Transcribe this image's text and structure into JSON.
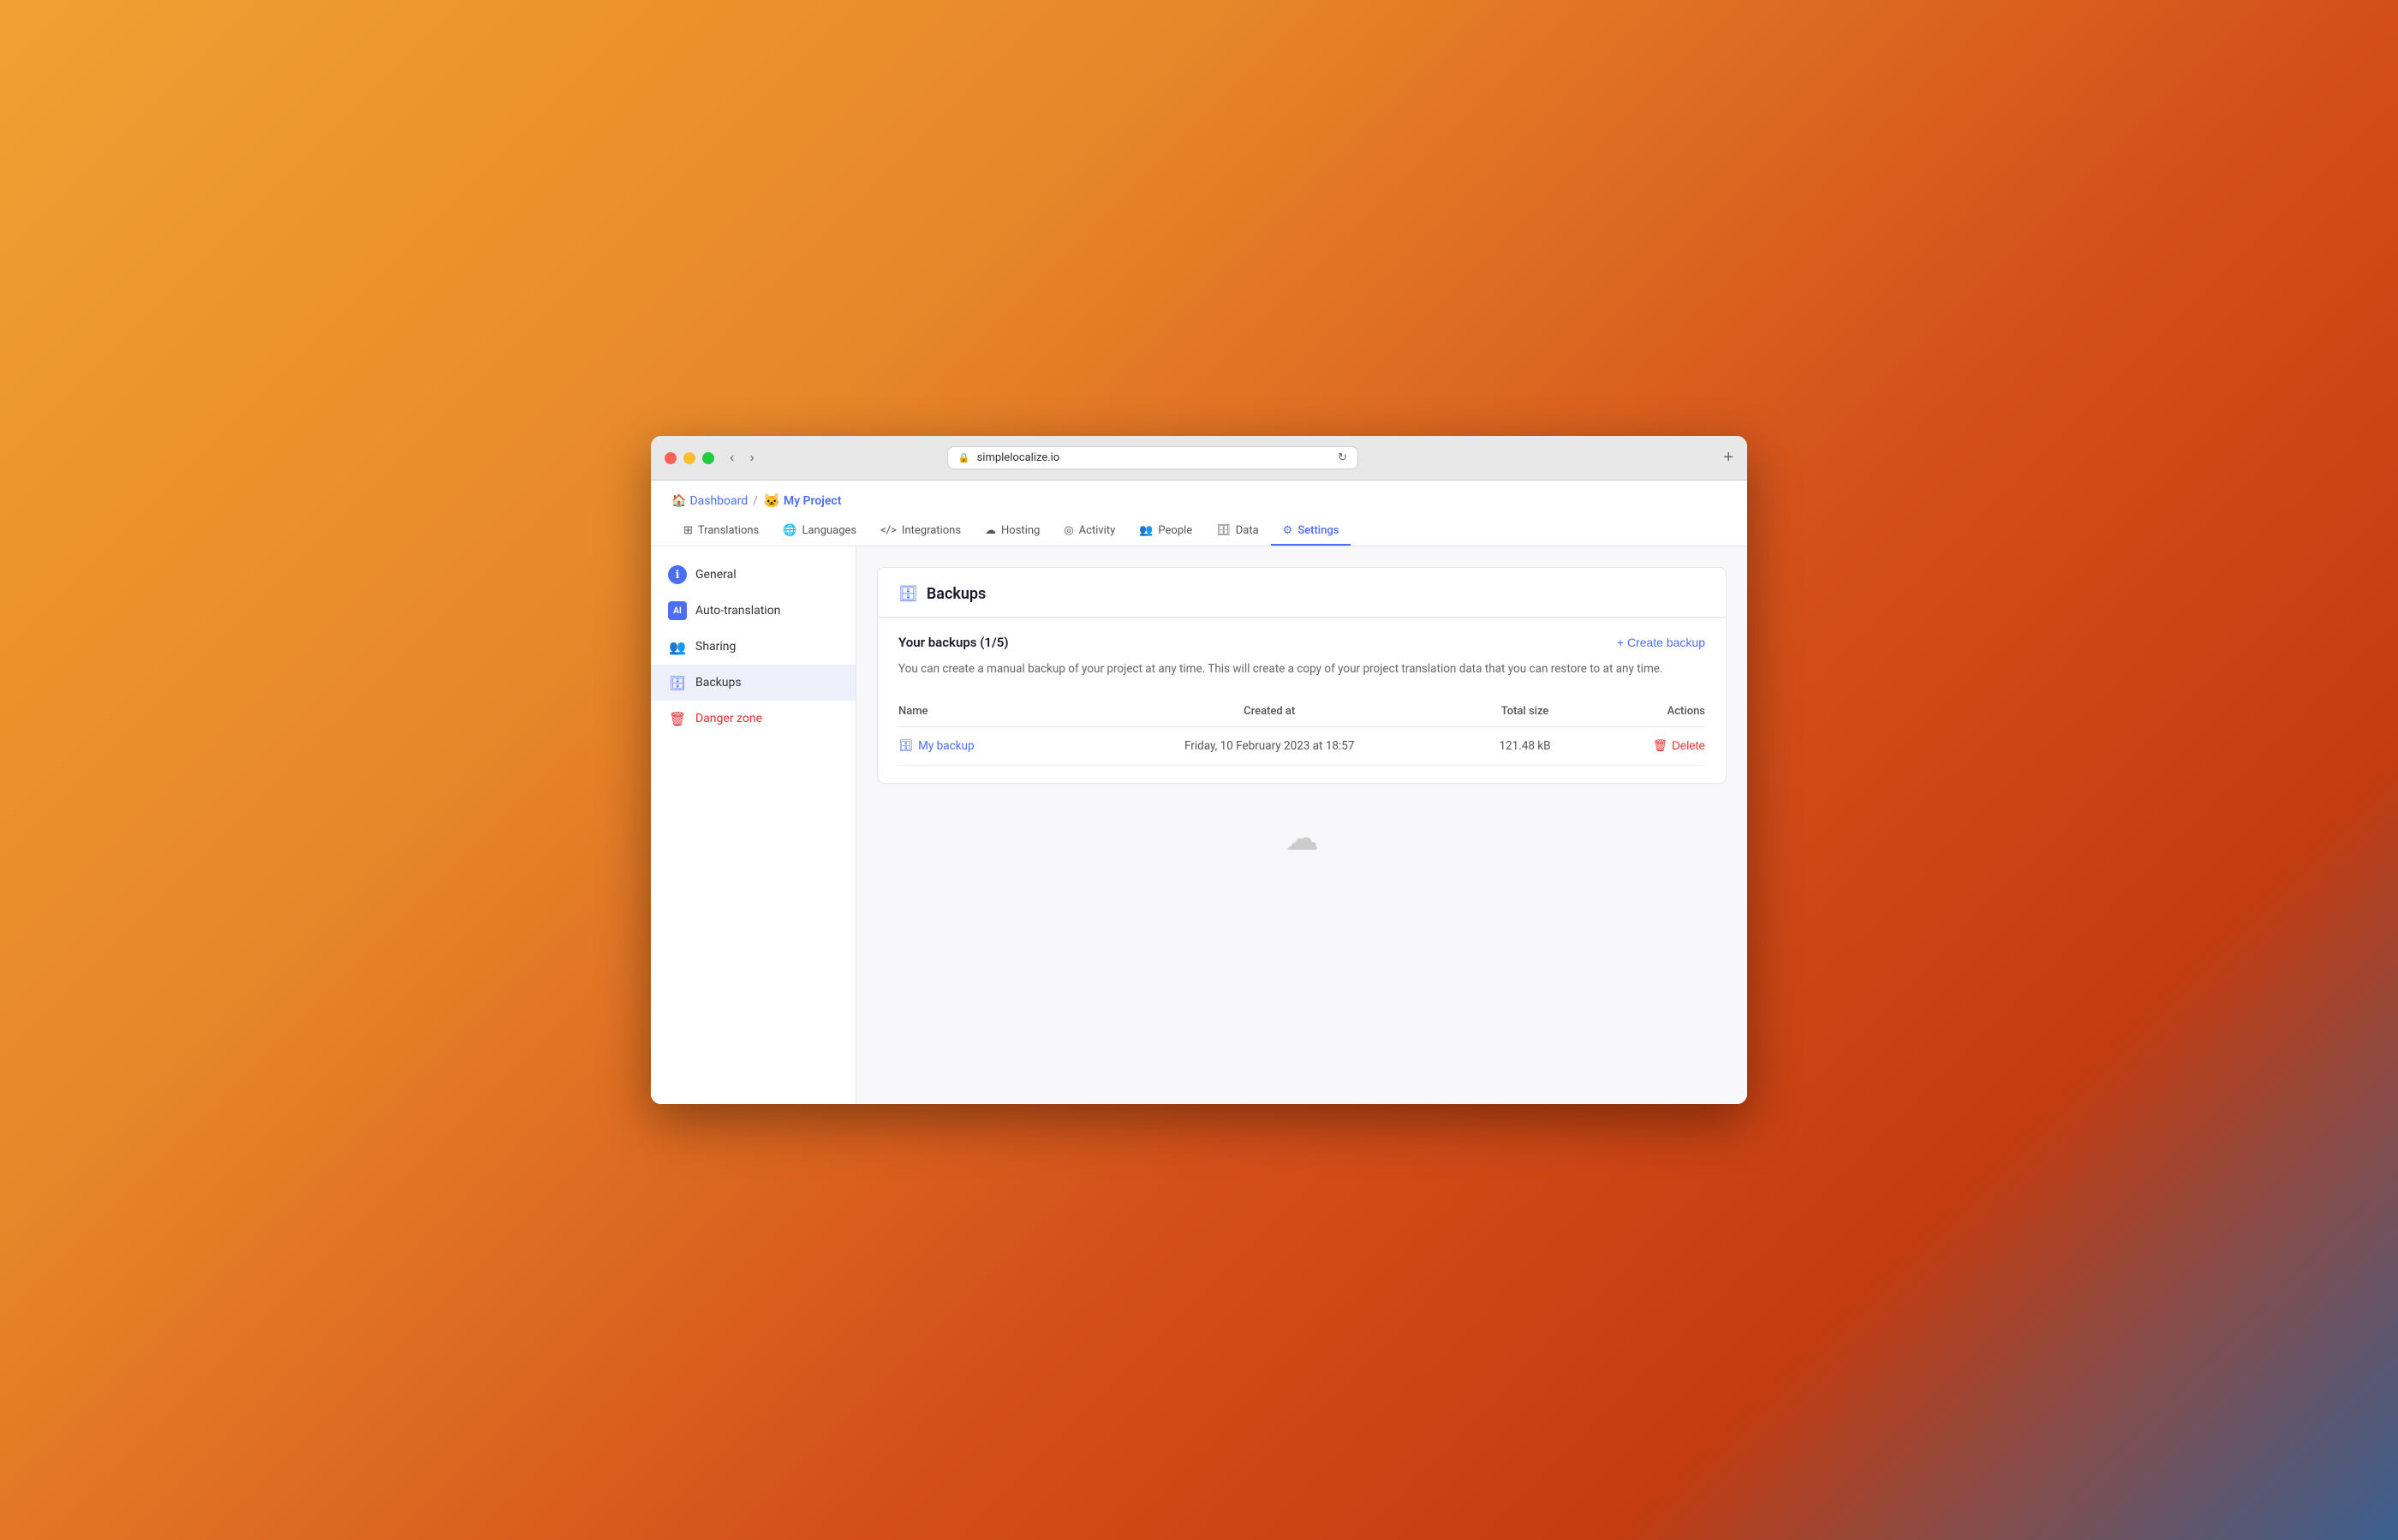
{
  "browser": {
    "url": "simplelocalize.io",
    "new_tab_label": "+"
  },
  "breadcrumb": {
    "home": "Dashboard",
    "separator": "/",
    "project": "My Project"
  },
  "nav_tabs": [
    {
      "id": "translations",
      "label": "Translations",
      "icon": "⊞",
      "active": false
    },
    {
      "id": "languages",
      "label": "Languages",
      "icon": "🌐",
      "active": false
    },
    {
      "id": "integrations",
      "label": "Integrations",
      "icon": "</>",
      "active": false
    },
    {
      "id": "hosting",
      "label": "Hosting",
      "icon": "☁",
      "active": false
    },
    {
      "id": "activity",
      "label": "Activity",
      "icon": "◎",
      "active": false
    },
    {
      "id": "people",
      "label": "People",
      "icon": "👥",
      "active": false
    },
    {
      "id": "data",
      "label": "Data",
      "icon": "🗄",
      "active": false
    },
    {
      "id": "settings",
      "label": "Settings",
      "icon": "⚙",
      "active": true
    }
  ],
  "sidebar": {
    "items": [
      {
        "id": "general",
        "label": "General",
        "icon": "ℹ",
        "icon_class": "icon-general",
        "active": false,
        "danger": false
      },
      {
        "id": "auto-translation",
        "label": "Auto-translation",
        "icon": "AI",
        "icon_class": "icon-autotrans",
        "active": false,
        "danger": false
      },
      {
        "id": "sharing",
        "label": "Sharing",
        "icon": "👥",
        "icon_class": "icon-sharing",
        "active": false,
        "danger": false
      },
      {
        "id": "backups",
        "label": "Backups",
        "icon": "🗄",
        "icon_class": "icon-backups",
        "active": true,
        "danger": false
      },
      {
        "id": "danger-zone",
        "label": "Danger zone",
        "icon": "🗑",
        "icon_class": "icon-danger",
        "active": false,
        "danger": true
      }
    ]
  },
  "main": {
    "card_title": "Backups",
    "backups_heading": "Your backups (1/5)",
    "create_backup_label": "+ Create backup",
    "description": "You can create a manual backup of your project at any time. This will create a copy of your project translation data that you can restore to at any time.",
    "table": {
      "columns": [
        "Name",
        "Created at",
        "Total size",
        "Actions"
      ],
      "rows": [
        {
          "name": "My backup",
          "created_at": "Friday, 10 February 2023 at 18:57",
          "total_size": "121.48 kB",
          "action_label": "Delete"
        }
      ]
    }
  }
}
